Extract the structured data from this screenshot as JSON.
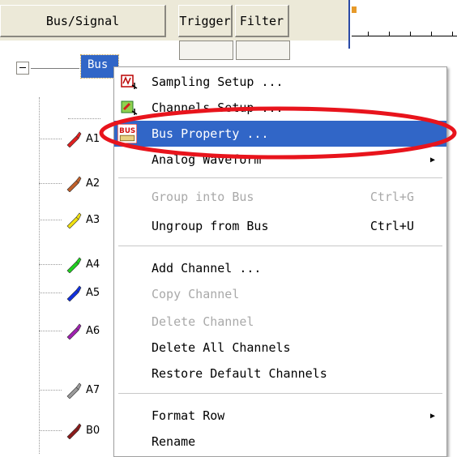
{
  "header": {
    "bus_signal": "Bus/Signal",
    "trigger": "Trigger",
    "filter": "Filter"
  },
  "tree": {
    "bus_label": "Bus",
    "rows": [
      {
        "label": "A1",
        "color": "#e02020"
      },
      {
        "label": "A2",
        "color": "#c0602a"
      },
      {
        "label": "A3",
        "color": "#f0e010"
      },
      {
        "label": "A4",
        "color": "#20d020"
      },
      {
        "label": "A5",
        "color": "#1030e0"
      },
      {
        "label": "A6",
        "color": "#a020b0"
      },
      {
        "label": "A7",
        "color": "#9a9a9a"
      },
      {
        "label": "B0",
        "color": "#8b1a1a"
      }
    ]
  },
  "menu": {
    "sampling_setup": "Sampling Setup ...",
    "channels_setup": "Channels Setup ...",
    "bus_property": "Bus Property ...",
    "bus_icon_text": "BUS",
    "analog_waveform": "Analog Waveform",
    "group_into_bus": "Group into Bus",
    "group_shortcut": "Ctrl+G",
    "ungroup_from_bus": "Ungroup from Bus",
    "ungroup_shortcut": "Ctrl+U",
    "add_channel": "Add Channel ...",
    "copy_channel": "Copy Channel",
    "delete_channel": "Delete Channel",
    "delete_all_channels": "Delete All Channels",
    "restore_default_channels": "Restore Default Channels",
    "format_row": "Format Row",
    "rename": "Rename",
    "submenu_arrow": "▶"
  },
  "colors": {
    "selection": "#3166c7",
    "annotation": "#e8141c"
  }
}
